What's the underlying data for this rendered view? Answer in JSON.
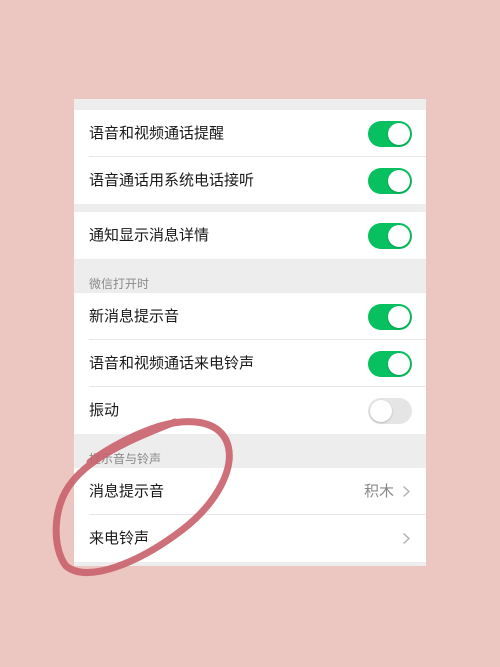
{
  "settings": {
    "call_reminder_label": "语音和视频通话提醒",
    "call_reminder_on": true,
    "system_phone_label": "语音通话用系统电话接听",
    "system_phone_on": true,
    "notification_details_label": "通知显示消息详情",
    "notification_details_on": true,
    "section_open_header": "微信打开时",
    "new_message_sound_label": "新消息提示音",
    "new_message_sound_on": true,
    "ringtone_toggle_label": "语音和视频通话来电铃声",
    "ringtone_toggle_on": true,
    "vibrate_label": "振动",
    "vibrate_on": false,
    "section_sounds_header": "提示音与铃声",
    "message_tone_label": "消息提示音",
    "message_tone_value": "积木",
    "ringtone_label": "来电铃声"
  },
  "colors": {
    "background": "#ecc6c1",
    "toggle_on": "#07c160",
    "toggle_off": "#e5e5e5",
    "circle_annotation": "#c9616b"
  },
  "icons": [
    "chevron-right-icon"
  ]
}
